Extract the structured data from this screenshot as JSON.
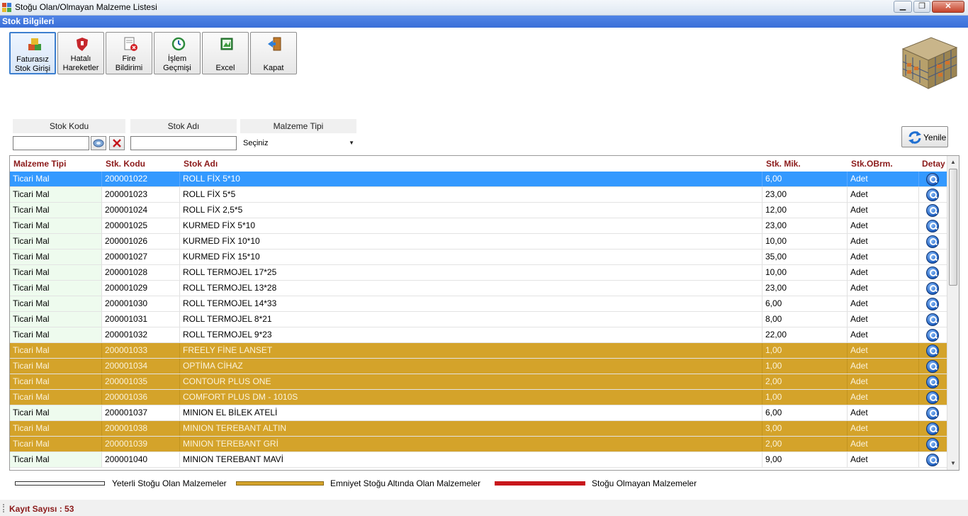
{
  "window": {
    "title": "Stoğu Olan/Olmayan Malzeme Listesi",
    "minimize": "▁",
    "maximize": "❐",
    "close": "✕"
  },
  "section_title": "Stok Bilgileri",
  "toolbar": [
    {
      "name": "faturasiz-stok-girisi-button",
      "label": "Faturasız\nStok Girişi",
      "icon": "boxes-icon"
    },
    {
      "name": "hatali-hareketler-button",
      "label": "Hatalı\nHareketler",
      "icon": "shield-icon"
    },
    {
      "name": "fire-bildirimi-button",
      "label": "Fire\nBildirimi",
      "icon": "document-error-icon"
    },
    {
      "name": "islem-gecmisi-button",
      "label": "İşlem\nGeçmişi",
      "icon": "history-icon"
    },
    {
      "name": "excel-button",
      "label": "Excel",
      "icon": "excel-icon"
    },
    {
      "name": "kapat-button",
      "label": "Kapat",
      "icon": "exit-door-icon"
    }
  ],
  "filters": {
    "stok_kodu_label": "Stok Kodu",
    "stok_adi_label": "Stok Adı",
    "malzeme_tipi_label": "Malzeme Tipi",
    "malzeme_tipi_value": "Seçiniz",
    "stok_kodu_value": "",
    "stok_adi_value": ""
  },
  "refresh_label": "Yenile",
  "grid": {
    "columns": [
      "Malzeme Tipi",
      "Stk. Kodu",
      "Stok Adı",
      "Stk. Mik.",
      "Stk.OBrm.",
      "Detay"
    ],
    "rows": [
      {
        "tip": "Ticari Mal",
        "kod": "200001022",
        "ad": "ROLL FİX 5*10",
        "mik": "6,00",
        "brm": "Adet",
        "state": "sel"
      },
      {
        "tip": "Ticari Mal",
        "kod": "200001023",
        "ad": "ROLL FİX 5*5",
        "mik": "23,00",
        "brm": "Adet",
        "state": "ok"
      },
      {
        "tip": "Ticari Mal",
        "kod": "200001024",
        "ad": "ROLL FİX 2,5*5",
        "mik": "12,00",
        "brm": "Adet",
        "state": "ok"
      },
      {
        "tip": "Ticari Mal",
        "kod": "200001025",
        "ad": "KURMED FİX 5*10",
        "mik": "23,00",
        "brm": "Adet",
        "state": "ok"
      },
      {
        "tip": "Ticari Mal",
        "kod": "200001026",
        "ad": "KURMED FİX 10*10",
        "mik": "10,00",
        "brm": "Adet",
        "state": "ok"
      },
      {
        "tip": "Ticari Mal",
        "kod": "200001027",
        "ad": "KURMED FİX 15*10",
        "mik": "35,00",
        "brm": "Adet",
        "state": "ok"
      },
      {
        "tip": "Ticari Mal",
        "kod": "200001028",
        "ad": "ROLL TERMOJEL 17*25",
        "mik": "10,00",
        "brm": "Adet",
        "state": "ok"
      },
      {
        "tip": "Ticari Mal",
        "kod": "200001029",
        "ad": "ROLL TERMOJEL 13*28",
        "mik": "23,00",
        "brm": "Adet",
        "state": "ok"
      },
      {
        "tip": "Ticari Mal",
        "kod": "200001030",
        "ad": "ROLL TERMOJEL 14*33",
        "mik": "6,00",
        "brm": "Adet",
        "state": "ok"
      },
      {
        "tip": "Ticari Mal",
        "kod": "200001031",
        "ad": "ROLL TERMOJEL 8*21",
        "mik": "8,00",
        "brm": "Adet",
        "state": "ok"
      },
      {
        "tip": "Ticari Mal",
        "kod": "200001032",
        "ad": "ROLL TERMOJEL 9*23",
        "mik": "22,00",
        "brm": "Adet",
        "state": "ok"
      },
      {
        "tip": "Ticari Mal",
        "kod": "200001033",
        "ad": "FREELY FİNE LANSET",
        "mik": "1,00",
        "brm": "Adet",
        "state": "low"
      },
      {
        "tip": "Ticari Mal",
        "kod": "200001034",
        "ad": "OPTİMA CİHAZ",
        "mik": "1,00",
        "brm": "Adet",
        "state": "low"
      },
      {
        "tip": "Ticari Mal",
        "kod": "200001035",
        "ad": "CONTOUR PLUS ONE",
        "mik": "2,00",
        "brm": "Adet",
        "state": "low"
      },
      {
        "tip": "Ticari Mal",
        "kod": "200001036",
        "ad": "COMFORT PLUS DM - 1010S",
        "mik": "1,00",
        "brm": "Adet",
        "state": "low"
      },
      {
        "tip": "Ticari Mal",
        "kod": "200001037",
        "ad": "MINION EL BİLEK ATELİ",
        "mik": "6,00",
        "brm": "Adet",
        "state": "ok"
      },
      {
        "tip": "Ticari Mal",
        "kod": "200001038",
        "ad": "MINION TEREBANT ALTIN",
        "mik": "3,00",
        "brm": "Adet",
        "state": "low"
      },
      {
        "tip": "Ticari Mal",
        "kod": "200001039",
        "ad": "MINION TEREBANT GRİ",
        "mik": "2,00",
        "brm": "Adet",
        "state": "low"
      },
      {
        "tip": "Ticari Mal",
        "kod": "200001040",
        "ad": "MINION TEREBANT MAVİ",
        "mik": "9,00",
        "brm": "Adet",
        "state": "ok"
      }
    ]
  },
  "legend": [
    {
      "label": "Yeterli Stoğu Olan Malzemeler",
      "color": "#ffffff"
    },
    {
      "label": "Emniyet Stoğu Altında Olan Malzemeler",
      "color": "#d4a32a"
    },
    {
      "label": "Stoğu Olmayan Malzemeler",
      "color": "#c8171b"
    }
  ],
  "status": {
    "record_count": "Kayıt Sayısı : 53"
  },
  "colors": {
    "header_blue": "#3a6fd8",
    "low_stock": "#d4a32a",
    "no_stock": "#c8171b",
    "selected": "#3399ff",
    "column_header_text": "#8b1a1a"
  }
}
